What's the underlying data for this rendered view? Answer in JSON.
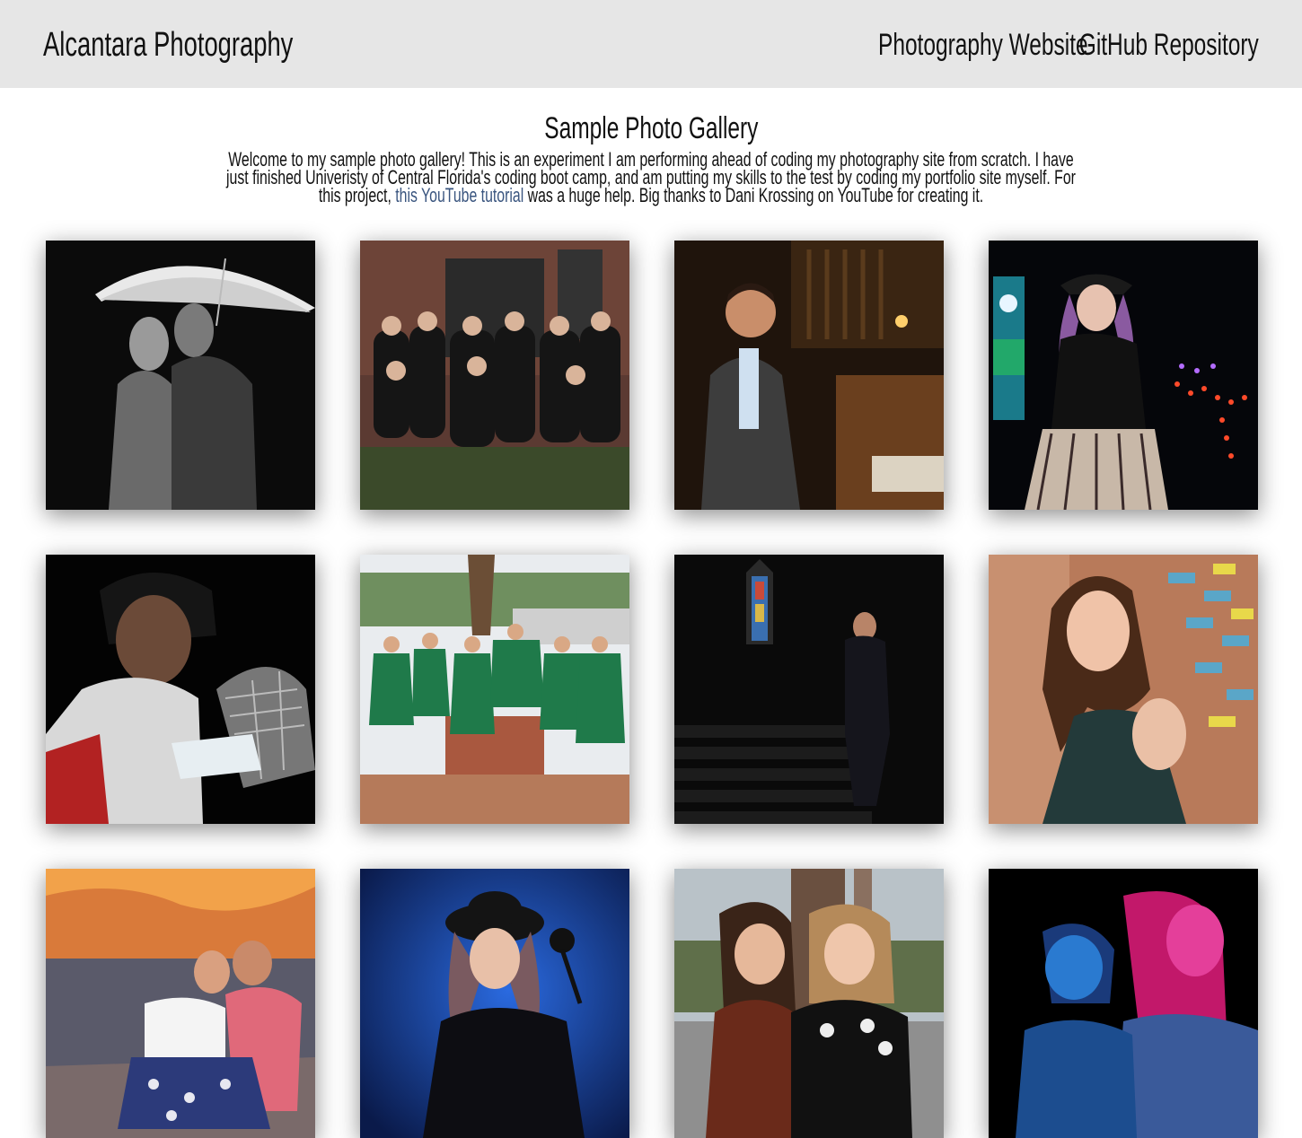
{
  "header": {
    "brand": "Alcantara Photography",
    "nav": [
      {
        "label": "Photography Website"
      },
      {
        "label": "GitHub Repository"
      }
    ]
  },
  "main": {
    "title": "Sample Photo Gallery",
    "intro_before_link": "Welcome to my sample photo gallery! This is an experiment I am performing ahead of coding my photography site from scratch. I have just finished Univeristy of Central Florida's coding boot camp, and am putting my skills to the test by coding my portfolio site myself. For this project, ",
    "intro_link": "this YouTube tutorial",
    "intro_after_link": " was a huge help. Big thanks to Dani Krossing on YouTube for creating it.",
    "link_color": "#3a557f"
  },
  "gallery": {
    "photos": [
      {
        "subject": "couple under white umbrella, black and white"
      },
      {
        "subject": "group of women in black in front of brick building"
      },
      {
        "subject": "man in suit beside pipe organ"
      },
      {
        "subject": "woman in hat at night with colorful lights"
      },
      {
        "subject": "young hockey goalie holding mask"
      },
      {
        "subject": "graduates in green gowns by statue"
      },
      {
        "subject": "man in suit on dark staircase with stained glass"
      },
      {
        "subject": "smiling woman against painted brick wall"
      },
      {
        "subject": "couple embracing at beach at sunset"
      },
      {
        "subject": "woman in black hat with blue backdrop"
      },
      {
        "subject": "two women smiling outdoors"
      },
      {
        "subject": "boy and girl in blue and pink light"
      }
    ]
  }
}
